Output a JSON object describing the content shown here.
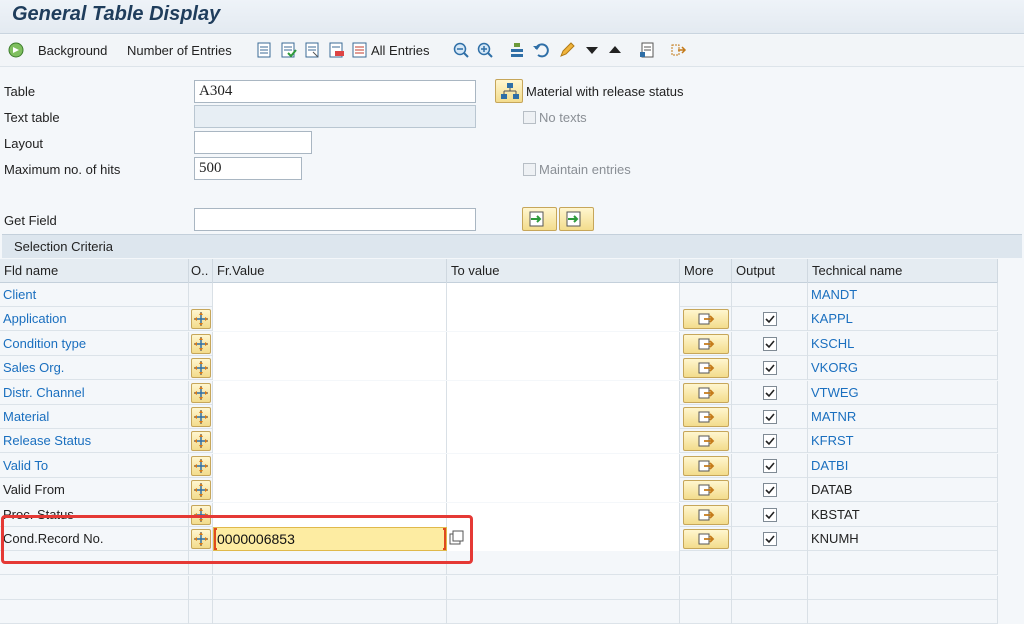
{
  "window": {
    "title": "General Table Display"
  },
  "toolbar": {
    "background_label": "Background",
    "number_of_entries_label": "Number of Entries",
    "all_entries_label": "All Entries"
  },
  "form": {
    "table_label": "Table",
    "table_value": "A304",
    "table_description": "Material with release status",
    "text_table_label": "Text table",
    "no_texts_label": "No texts",
    "layout_label": "Layout",
    "max_hits_label": "Maximum no. of hits",
    "max_hits_value": "500",
    "maintain_entries_label": "Maintain entries",
    "get_field_label": "Get Field"
  },
  "selection": {
    "title": "Selection Criteria",
    "columns": {
      "fld_name": "Fld name",
      "option": "O..",
      "from": "Fr.Value",
      "to": "To value",
      "more": "More",
      "output": "Output",
      "technical": "Technical name"
    },
    "rows": [
      {
        "name": "Client",
        "technical": "MANDT"
      },
      {
        "name": "Application",
        "technical": "KAPPL"
      },
      {
        "name": "Condition type",
        "technical": "KSCHL"
      },
      {
        "name": "Sales Org.",
        "technical": "VKORG"
      },
      {
        "name": "Distr. Channel",
        "technical": "VTWEG"
      },
      {
        "name": "Material",
        "technical": "MATNR"
      },
      {
        "name": "Release Status",
        "technical": "KFRST"
      },
      {
        "name": "Valid To",
        "technical": "DATBI"
      },
      {
        "name": "Valid From",
        "technical": "DATAB"
      },
      {
        "name": "Proc. Status",
        "technical": "KBSTAT"
      },
      {
        "name": "Cond.Record No.",
        "technical": "KNUMH",
        "from_value": "0000006853"
      }
    ]
  },
  "colors": {
    "accent": "#1f3d5c",
    "link": "#1a6fbf",
    "highlight_border": "#e53935",
    "input_highlight": "#fdeca2"
  }
}
